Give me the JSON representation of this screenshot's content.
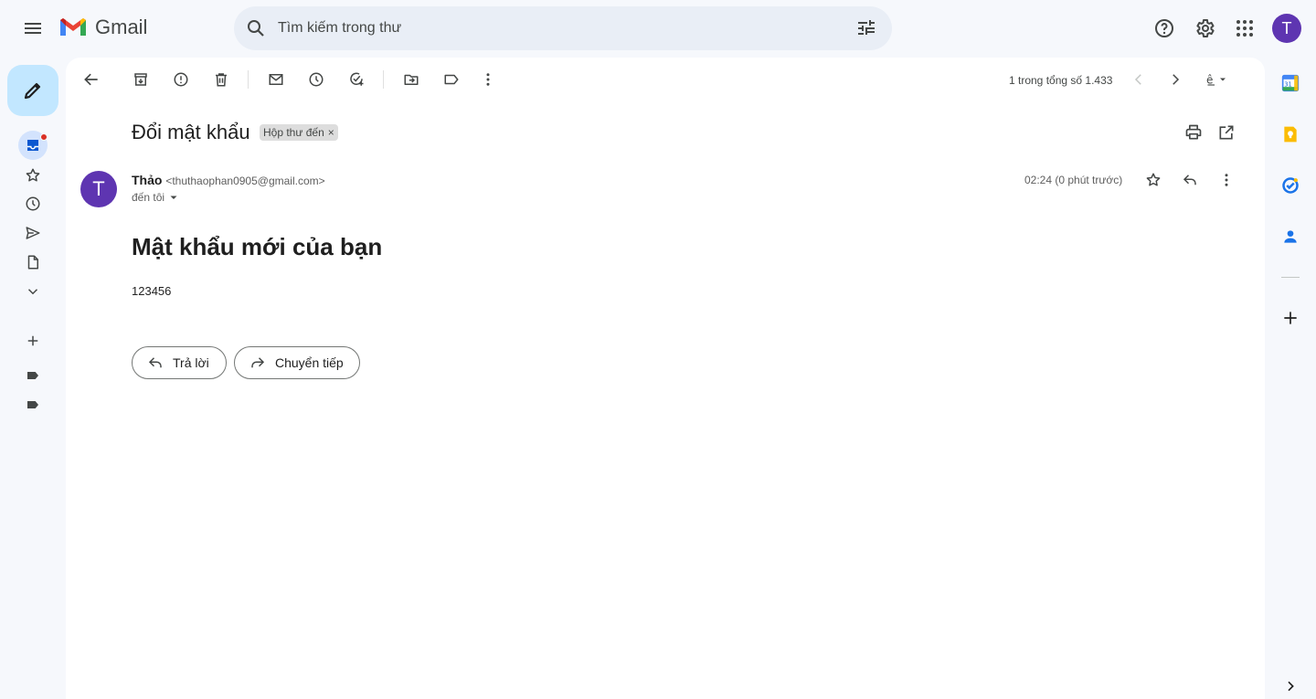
{
  "app": {
    "name": "Gmail"
  },
  "search": {
    "placeholder": "Tìm kiếm trong thư"
  },
  "account": {
    "initial": "T"
  },
  "toolbar": {
    "pager_text": "1 trong tổng số 1.433"
  },
  "message": {
    "subject": "Đổi mật khẩu",
    "label_chip": "Hộp thư đến",
    "label_close": "×",
    "sender_name": "Thảo",
    "sender_email": "<thuthaophan0905@gmail.com>",
    "sender_initial": "T",
    "to_text": "đến tôi",
    "time": "02:24 (0 phút trước)",
    "body_title": "Mật khẩu mới của bạn",
    "body_text": "123456"
  },
  "actions": {
    "reply_label": "Trả lời",
    "forward_label": "Chuyển tiếp"
  },
  "right_rail": {
    "calendar_day": "31"
  },
  "colors": {
    "accent": "#0b57d0",
    "avatar": "#5e35b1",
    "compose_bg": "#c2e7ff",
    "unread_dot": "#d93025"
  }
}
